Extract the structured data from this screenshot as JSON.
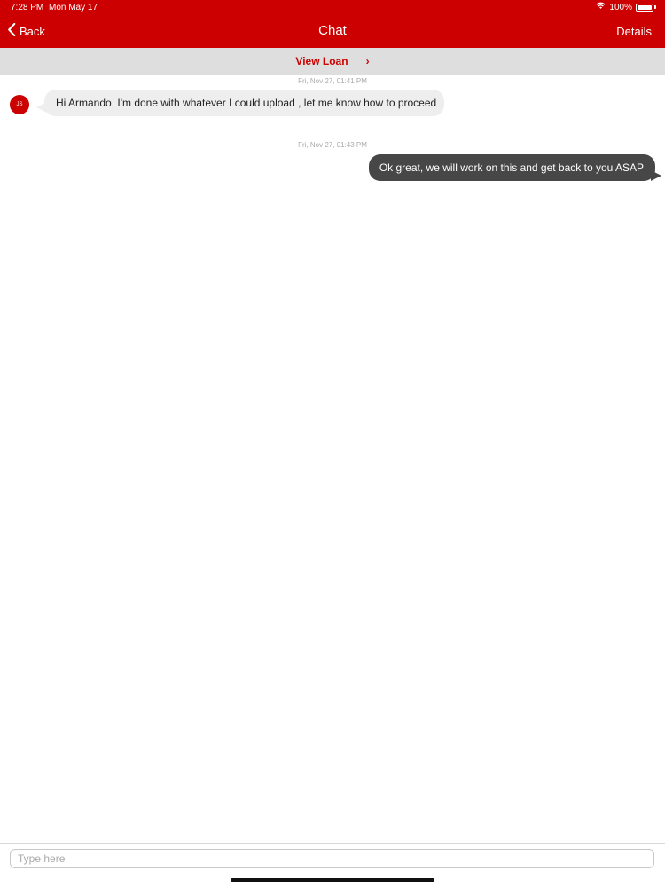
{
  "status_bar": {
    "time": "7:28 PM",
    "date": "Mon May 17",
    "battery": "100%",
    "battery_level": 1.0,
    "wifi_icon": "wifi-icon"
  },
  "nav": {
    "back_label": "Back",
    "title": "Chat",
    "details_label": "Details"
  },
  "loan_bar": {
    "label": "View Loan",
    "chevron": "›"
  },
  "messages": [
    {
      "timestamp": "Fri, Nov 27, 01:41 PM",
      "direction": "incoming",
      "avatar_initials": "JS",
      "text": "Hi Armando, I'm done with whatever I could upload , let me know how to proceed"
    },
    {
      "timestamp": "Fri, Nov 27, 01:43 PM",
      "direction": "outgoing",
      "text": "Ok great, we will work on this and get back to you ASAP"
    }
  ],
  "composer": {
    "placeholder": "Type here",
    "value": ""
  },
  "colors": {
    "brand_red": "#cc0000",
    "incoming_bubble": "#eeeeee",
    "outgoing_bubble": "#474747",
    "loan_bar_bg": "#dedede"
  }
}
